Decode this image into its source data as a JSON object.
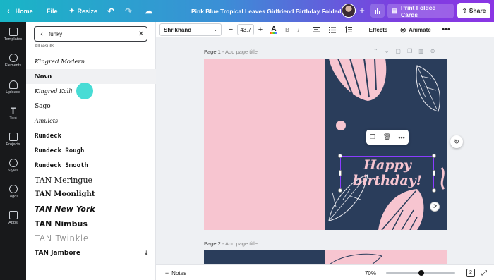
{
  "topbar": {
    "home_label": "Home",
    "file_label": "File",
    "resize_label": "Resize",
    "title": "Pink Blue Tropical Leaves Girlfriend Birthday Folded Card",
    "print_label": "Print Folded Cards",
    "share_label": "Share"
  },
  "leftnav": {
    "items": [
      {
        "label": "Templates",
        "icon": "templates-icon"
      },
      {
        "label": "Elements",
        "icon": "elements-icon"
      },
      {
        "label": "Uploads",
        "icon": "uploads-icon"
      },
      {
        "label": "Text",
        "icon": "text-icon"
      },
      {
        "label": "Projects",
        "icon": "projects-icon"
      },
      {
        "label": "Styles",
        "icon": "styles-icon"
      },
      {
        "label": "Logos",
        "icon": "logos-icon"
      },
      {
        "label": "Apps",
        "icon": "apps-icon"
      }
    ]
  },
  "panel": {
    "search_value": "funky",
    "all_results": "All results",
    "fonts": [
      "Kingred Modern",
      "Novo",
      "Kingred Kalli",
      "Sago",
      "Amulets",
      "Rundeck",
      "Rundeck Rough",
      "Rundeck Smooth",
      "TAN Meringue",
      "TAN Moonlight",
      "TAN New York",
      "TAN Nimbus",
      "TAN Twinkle",
      "TAN Jambore"
    ]
  },
  "toolbar": {
    "font_name": "Shrikhand",
    "font_size": "43.7",
    "effects_label": "Effects",
    "animate_label": "Animate"
  },
  "canvas": {
    "page1_label": "Page 1",
    "page1_add": "- Add page title",
    "page2_label": "Page 2",
    "page2_add": "- Add page title",
    "greeting_line1": "Happy",
    "greeting_line2": "birthday!"
  },
  "bottombar": {
    "notes_label": "Notes",
    "zoom": "70%",
    "page_count": "2"
  },
  "colors": {
    "pink": "#f7c5d0",
    "navy": "#2a3d5b",
    "selection": "#8b3dff"
  }
}
